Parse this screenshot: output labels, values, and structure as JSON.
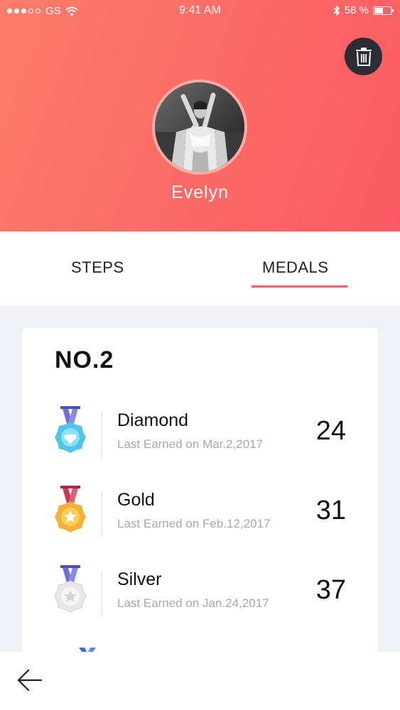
{
  "status_bar": {
    "carrier": "GS",
    "time": "9:41 AM",
    "battery_text": "58 %",
    "battery_level": 0.58,
    "signal_dots_filled": 3,
    "signal_dots_total": 5
  },
  "profile": {
    "name": "Evelyn",
    "avatar_icon": "profile-photo",
    "delete_icon": "trash-icon"
  },
  "tabs": [
    {
      "label": "STEPS",
      "selected": false
    },
    {
      "label": "MEDALS",
      "selected": true
    }
  ],
  "medals_card": {
    "rank": "NO.2",
    "items": [
      {
        "name": "Diamond",
        "subtitle": "Last Earned on Mar.2,2017",
        "count": "24",
        "icon": "diamond-medal-icon"
      },
      {
        "name": "Gold",
        "subtitle": "Last Earned on Feb.12,2017",
        "count": "31",
        "icon": "gold-medal-icon"
      },
      {
        "name": "Silver",
        "subtitle": "Last Earned on Jan.24,2017",
        "count": "37",
        "icon": "silver-medal-icon"
      }
    ]
  },
  "colors": {
    "header_gradient_start": "#fb7d6a",
    "header_gradient_end": "#fb5a62",
    "accent": "#ef5b67",
    "trash_button_bg": "#2c2c36"
  }
}
